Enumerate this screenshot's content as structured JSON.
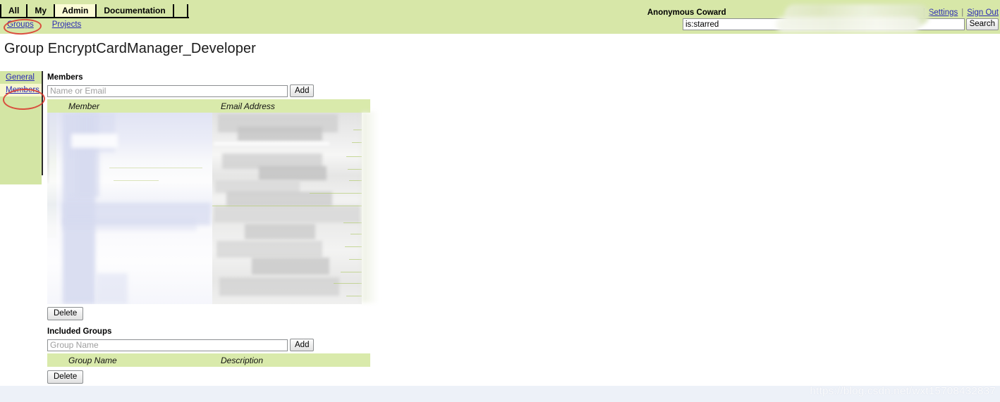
{
  "header": {
    "tabs": [
      {
        "label": "All",
        "selected": false
      },
      {
        "label": "My",
        "selected": false
      },
      {
        "label": "Admin",
        "selected": true
      },
      {
        "label": "Documentation",
        "selected": false
      }
    ],
    "subnav": [
      {
        "label": "Groups"
      },
      {
        "label": "Projects"
      }
    ],
    "user": {
      "name": "Anonymous Coward",
      "settings_label": "Settings",
      "signout_label": "Sign Out",
      "separator": "|"
    },
    "search": {
      "value": "is:starred",
      "placeholder": "Search",
      "button_label": "Search"
    },
    "background_color": "#d7e7a8",
    "selected_tab_color": "#fbfbd6"
  },
  "page": {
    "title": "Group EncryptCardManager_Developer"
  },
  "sidebar": {
    "items": [
      {
        "label": "General",
        "active": false
      },
      {
        "label": "Members",
        "active": true
      }
    ],
    "background_color": "#d3e5a4",
    "active_color": "#f7f7cf"
  },
  "members_section": {
    "title": "Members",
    "input_placeholder": "Name or Email",
    "input_value": "",
    "add_label": "Add",
    "delete_label": "Delete",
    "columns": [
      "",
      "Member",
      "Email Address"
    ],
    "rows": []
  },
  "included_groups_section": {
    "title": "Included Groups",
    "input_placeholder": "Group Name",
    "input_value": "",
    "add_label": "Add",
    "delete_label": "Delete",
    "columns": [
      "",
      "Group Name",
      "Description"
    ],
    "rows": []
  },
  "watermark": {
    "text": "https://blog.csdn.net/wxt15708432837"
  },
  "colors": {
    "link": "#2a2ab4",
    "table_header": "#d9eaab",
    "annotation": "#d9392f",
    "bottom_band": "#edf1f8"
  }
}
